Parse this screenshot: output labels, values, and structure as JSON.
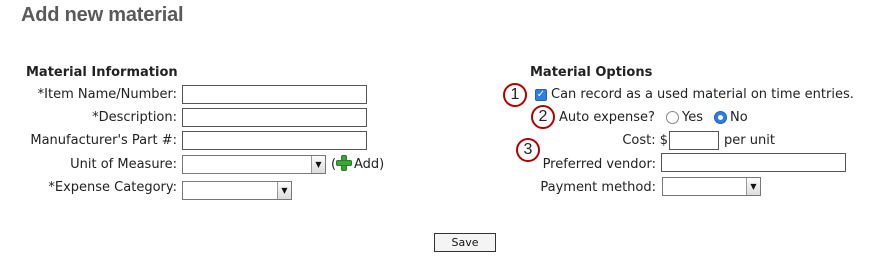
{
  "page": {
    "title": "Add new material"
  },
  "material_info": {
    "heading": "Material Information",
    "fields": {
      "item_name": {
        "label": "*Item Name/Number:",
        "value": ""
      },
      "description": {
        "label": "*Description:",
        "value": ""
      },
      "manufacturer_part": {
        "label": "Manufacturer's Part #:",
        "value": ""
      },
      "unit_of_measure": {
        "label": "Unit of Measure:",
        "selected": ""
      },
      "expense_category": {
        "label": "*Expense Category:",
        "selected": ""
      }
    },
    "add": {
      "paren_open": "(",
      "label": "Add)"
    }
  },
  "material_options": {
    "heading": "Material Options",
    "record_used": {
      "label": "Can record as a used material on time entries.",
      "checked": true
    },
    "auto_expense": {
      "label": "Auto expense?",
      "options": [
        {
          "label": "Yes",
          "selected": false
        },
        {
          "label": "No",
          "selected": true
        }
      ]
    },
    "cost": {
      "label": "Cost: $",
      "value": "",
      "suffix": "per unit"
    },
    "preferred_vendor": {
      "label": "Preferred vendor:",
      "value": ""
    },
    "payment_method": {
      "label": "Payment method:",
      "selected": ""
    }
  },
  "annotations": [
    "1",
    "2",
    "3"
  ],
  "actions": {
    "save_label": "Save"
  },
  "colors": {
    "title": "#5a5a5a",
    "annotation_border": "#b30000",
    "check_blue": "#2f7fe0",
    "add_green": "#3aa63a"
  },
  "icons": {
    "add": "plus-icon",
    "dropdown": "dropdown-arrow-icon"
  }
}
